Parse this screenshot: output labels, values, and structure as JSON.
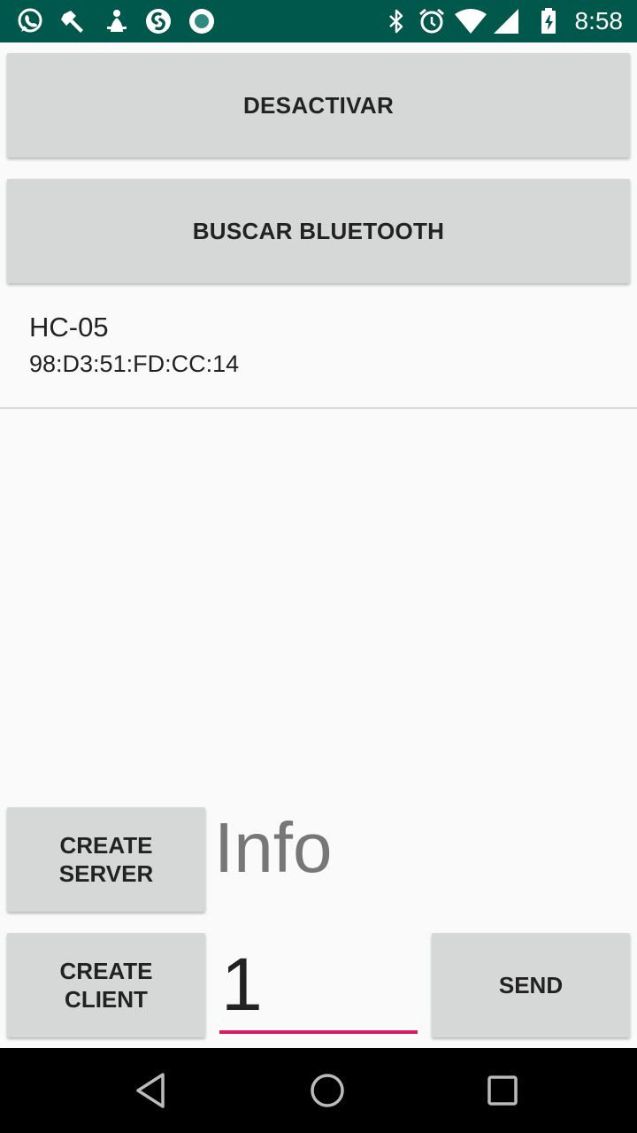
{
  "status_bar": {
    "time": "8:58",
    "left_icons": [
      "whatsapp-icon",
      "tool-icon",
      "person-icon",
      "shazam-icon",
      "record-icon"
    ],
    "right_icons": [
      "bluetooth-icon",
      "alarm-icon",
      "wifi-icon",
      "signal-icon",
      "battery-icon"
    ]
  },
  "buttons": {
    "deactivate": "DESACTIVAR",
    "search_bluetooth": "BUSCAR BLUETOOTH",
    "create_server": "CREATE\nSERVER",
    "create_client": "CREATE\nCLIENT",
    "send": "SEND"
  },
  "devices": [
    {
      "name": "HC-05",
      "address": "98:D3:51:FD:CC:14"
    }
  ],
  "info_label": "Info",
  "message_input": {
    "value": "1"
  },
  "nav_bar": {
    "buttons": [
      "back-icon",
      "home-icon",
      "recents-icon"
    ]
  },
  "colors": {
    "status_bar": "#00574b",
    "button_bg": "#d6d7d7",
    "accent_underline": "#d81b60",
    "background": "#fafafa"
  }
}
